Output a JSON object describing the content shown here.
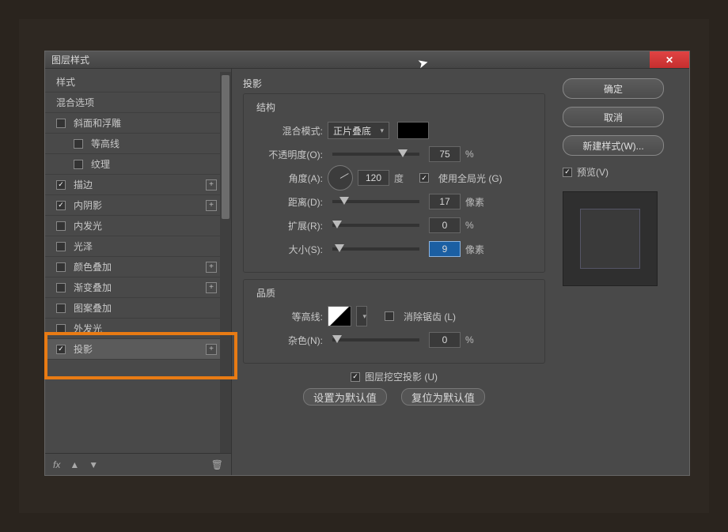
{
  "dialog_title": "图层样式",
  "sidebar": {
    "items": [
      {
        "label": "样式",
        "chk": null
      },
      {
        "label": "混合选项",
        "chk": null
      },
      {
        "label": "斜面和浮雕",
        "chk": false
      },
      {
        "label": "等高线",
        "chk": false,
        "indent": true
      },
      {
        "label": "纹理",
        "chk": false,
        "indent": true
      },
      {
        "label": "描边",
        "chk": true,
        "plus": true
      },
      {
        "label": "内阴影",
        "chk": true,
        "plus": true
      },
      {
        "label": "内发光",
        "chk": false
      },
      {
        "label": "光泽",
        "chk": false
      },
      {
        "label": "颜色叠加",
        "chk": false,
        "plus": true
      },
      {
        "label": "渐变叠加",
        "chk": false,
        "plus": true
      },
      {
        "label": "图案叠加",
        "chk": false
      },
      {
        "label": "外发光",
        "chk": false
      },
      {
        "label": "投影",
        "chk": true,
        "plus": true,
        "active": true
      }
    ],
    "fx": "fx",
    "up": "▲",
    "down": "▼",
    "trash": "🗑"
  },
  "panel_title": "投影",
  "structure": {
    "legend": "结构",
    "blend_label": "混合模式:",
    "blend_value": "正片叠底",
    "opacity_label": "不透明度(O):",
    "opacity_value": "75",
    "angle_label": "角度(A):",
    "angle_value": "120",
    "angle_unit": "度",
    "global_light": "使用全局光 (G)",
    "distance_label": "距离(D):",
    "distance_value": "17",
    "spread_label": "扩展(R):",
    "spread_value": "0",
    "size_label": "大小(S):",
    "size_value": "9",
    "px_unit": "像素",
    "pct_unit": "%"
  },
  "quality": {
    "legend": "品质",
    "contour_label": "等高线:",
    "antialias": "消除锯齿 (L)",
    "noise_label": "杂色(N):",
    "noise_value": "0"
  },
  "knockout": "图层挖空投影 (U)",
  "reset_btn": "设置为默认值",
  "revert_btn": "复位为默认值",
  "right": {
    "ok": "确定",
    "cancel": "取消",
    "new_style": "新建样式(W)...",
    "preview": "预览(V)"
  },
  "close_x": "✕"
}
